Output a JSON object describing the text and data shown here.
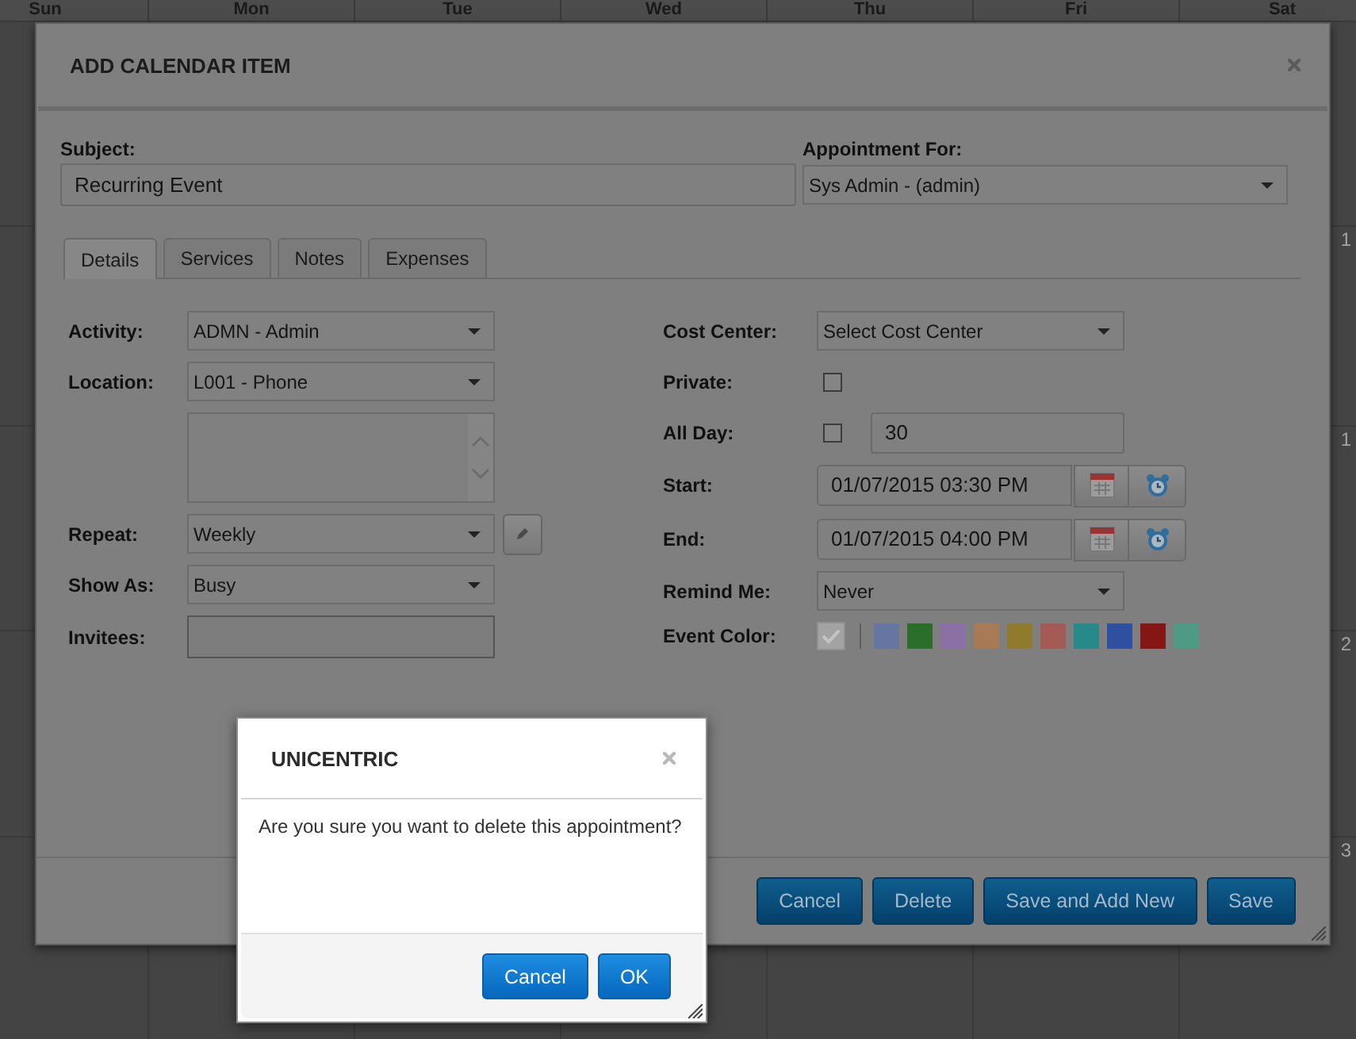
{
  "calendar": {
    "day_names": [
      "Sun",
      "Mon",
      "Tue",
      "Wed",
      "Thu",
      "Fri",
      "Sat"
    ],
    "week_rows": [
      {
        "date": "1"
      },
      {
        "date": "1"
      },
      {
        "date": "2"
      },
      {
        "date": "3"
      }
    ]
  },
  "dialog": {
    "title": "ADD CALENDAR ITEM",
    "subject": {
      "label": "Subject:",
      "value": "Recurring Event"
    },
    "appointment_for": {
      "label": "Appointment For:",
      "value": "Sys Admin - (admin)"
    },
    "tabs": [
      {
        "label": "Details",
        "selected": true
      },
      {
        "label": "Services",
        "selected": false
      },
      {
        "label": "Notes",
        "selected": false
      },
      {
        "label": "Expenses",
        "selected": false
      }
    ],
    "left_fields": [
      {
        "kind": "select",
        "label": "Activity:",
        "value": "ADMN - Admin"
      },
      {
        "kind": "select",
        "label": "Location:",
        "value": "L001 - Phone"
      },
      {
        "kind": "textarea"
      },
      {
        "kind": "select",
        "label": "Repeat:",
        "value": "Weekly",
        "edit_button": true
      },
      {
        "kind": "select",
        "label": "Show As:",
        "value": "Busy"
      },
      {
        "kind": "input",
        "label": "Invitees:"
      }
    ],
    "right_fields": [
      {
        "kind": "select",
        "label": "Cost Center:",
        "value": "Select Cost Center"
      },
      {
        "kind": "checkbox",
        "label": "Private:",
        "checked": false
      },
      {
        "kind": "checkbox",
        "label": "All Day:",
        "checked": false,
        "value": "30"
      },
      {
        "kind": "datetime",
        "label": "Start:",
        "value": "01/07/2015 03:30 PM"
      },
      {
        "kind": "datetime",
        "label": "End:",
        "value": "01/07/2015 04:00 PM"
      },
      {
        "kind": "select",
        "label": "Remind Me:",
        "value": "Never"
      },
      {
        "kind": "colors",
        "label": "Event Color:",
        "swatches": [
          {
            "kind": "default",
            "color": "#a3a3a3",
            "selected": true
          },
          {
            "kind": "color",
            "color": "#6577a0",
            "selected": false
          },
          {
            "kind": "color",
            "color": "#2a6e2a",
            "selected": false
          },
          {
            "kind": "color",
            "color": "#8b70a5",
            "selected": false
          },
          {
            "kind": "color",
            "color": "#a77b55",
            "selected": false
          },
          {
            "kind": "color",
            "color": "#8f7a2e",
            "selected": false
          },
          {
            "kind": "color",
            "color": "#a45a55",
            "selected": false
          },
          {
            "kind": "color",
            "color": "#27898a",
            "selected": false
          },
          {
            "kind": "color",
            "color": "#2f50a0",
            "selected": false
          },
          {
            "kind": "color",
            "color": "#841616",
            "selected": false
          },
          {
            "kind": "color",
            "color": "#4e9a82",
            "selected": false
          }
        ]
      }
    ],
    "buttons": [
      "Cancel",
      "Delete",
      "Save and Add New",
      "Save"
    ]
  },
  "confirm_dialog": {
    "title": "UNICENTRIC",
    "message": "Are you sure you want to delete this appointment?",
    "buttons": [
      "Cancel",
      "OK"
    ]
  }
}
